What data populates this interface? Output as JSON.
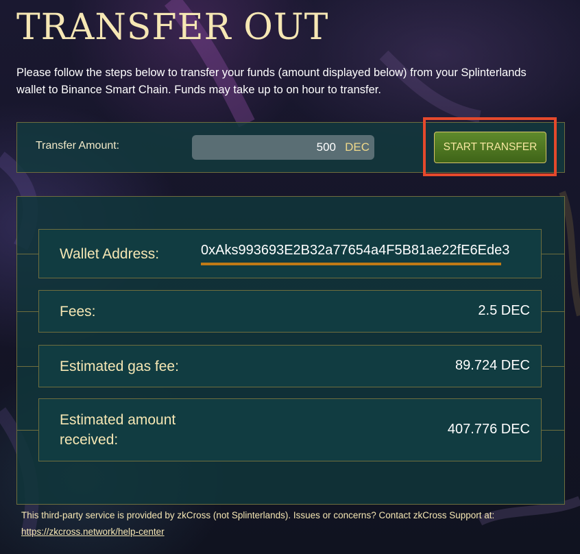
{
  "page": {
    "title": "TRANSFER OUT",
    "intro": "Please follow the steps below to transfer your funds (amount displayed below) from your Splinterlands wallet to Binance Smart Chain. Funds may take up to on hour to transfer."
  },
  "transfer": {
    "amount_label": "Transfer Amount:",
    "amount_value": "500",
    "amount_unit": "DEC",
    "start_button": "START TRANSFER"
  },
  "details": {
    "wallet_label": "Wallet Address:",
    "wallet_value": "0xAks993693E2B32a77654a4F5B81ae22fE6Ede3",
    "fees_label": "Fees:",
    "fees_value": "2.5 DEC",
    "gas_label": "Estimated gas fee:",
    "gas_value": "89.724 DEC",
    "received_label": "Estimated amount received:",
    "received_value": "407.776 DEC"
  },
  "footer": {
    "text": "This third-party service is provided by zkCross (not Splinterlands). Issues or concerns? Contact zkCross Support at:",
    "link": "https://zkcross.network/help-center"
  },
  "colors": {
    "title": "#f6e7b4",
    "button": "#4f7a22",
    "highlight": "#e5492c",
    "underline": "#c07a16",
    "panel": "#113c41"
  }
}
